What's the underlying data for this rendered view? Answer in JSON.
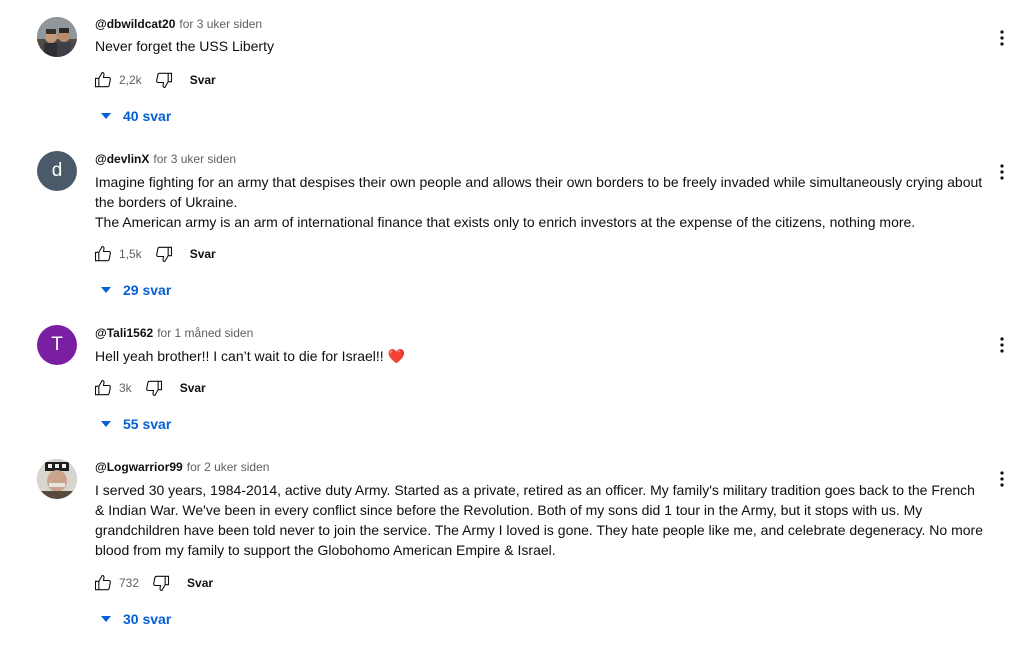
{
  "colors": {
    "link_blue": "#065fd4",
    "muted_text": "#606060",
    "avatar_d": "#4b5a68",
    "avatar_t": "#7a1fa2",
    "heart": "#e53935"
  },
  "icons": {
    "like": "thumb-up-outline-icon",
    "dislike": "thumb-down-outline-icon",
    "menu": "more-vertical-icon",
    "replies_caret": "caret-down-icon",
    "heart": "red-heart-emoji"
  },
  "comments": [
    {
      "handle": "@dbwildcat20",
      "time": "for 3 uker siden",
      "avatar_letter": "",
      "paragraphs": [
        "Never forget the USS Liberty"
      ],
      "likes": "2,2k",
      "reply_label": "Svar",
      "replies_label": "40 svar"
    },
    {
      "handle": "@devlinX",
      "time": "for 3 uker siden",
      "avatar_letter": "d",
      "paragraphs": [
        "Imagine fighting for an army that despises their own people and allows their own borders to be freely invaded while simultaneously crying about the borders of Ukraine.",
        "The American army is an arm of international finance that exists only to enrich investors at the expense of the citizens, nothing more."
      ],
      "likes": "1,5k",
      "reply_label": "Svar",
      "replies_label": "29 svar"
    },
    {
      "handle": "@Tali1562",
      "time": "for 1 måned siden",
      "avatar_letter": "T",
      "paragraphs": [
        "Hell yeah brother!! I can’t wait to die for Israel!! "
      ],
      "heart_emoji": "❤️",
      "likes": "3k",
      "reply_label": "Svar",
      "replies_label": "55 svar"
    },
    {
      "handle": "@Logwarrior99",
      "time": "for 2 uker siden",
      "avatar_letter": "",
      "paragraphs": [
        "I served 30 years, 1984-2014, active duty Army. Started as a private, retired as an officer. My family's military tradition goes back to the French & Indian War. We've been in every conflict since before the Revolution. Both of my sons did 1 tour in the Army, but it stops with us. My grandchildren have been told never to join the service. The Army I loved is gone. They hate people like me, and celebrate degeneracy. No more blood from my family to support the Globohomo American Empire & Israel."
      ],
      "likes": "732",
      "reply_label": "Svar",
      "replies_label": "30 svar"
    }
  ]
}
